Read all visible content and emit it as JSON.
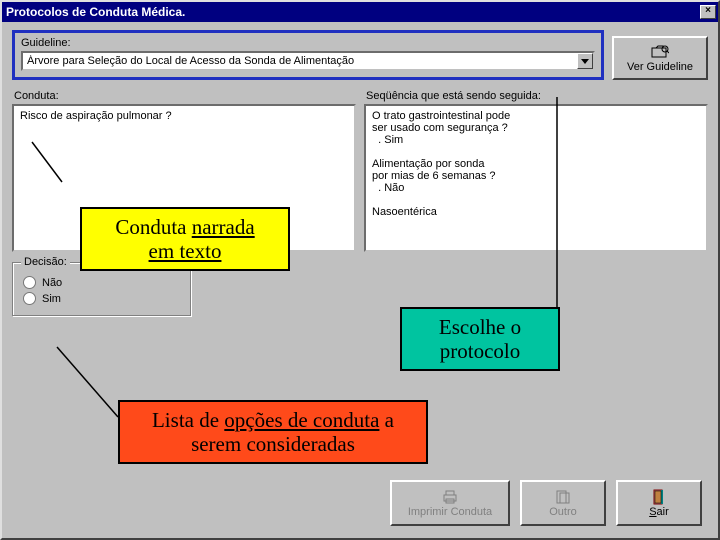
{
  "title": "Protocolos de Conduta Médica.",
  "guideline": {
    "label": "Guideline:",
    "value": "Árvore para Seleção do Local de Acesso da Sonda de Alimentação",
    "view_button": "Ver Guideline"
  },
  "conduta": {
    "label": "Conduta:",
    "text": "Risco de aspiração pulmonar ?"
  },
  "sequencia": {
    "label": "Seqüência que está sendo seguida:",
    "text": "O trato gastrointestinal pode\nser usado com segurança ?\n  . Sim\n\nAlimentação por sonda\npor mias de 6 semanas ?\n  . Não\n\nNasoentérica"
  },
  "decisao": {
    "legend": "Decisão:",
    "options": [
      "Não",
      "Sim"
    ]
  },
  "buttons": {
    "imprimir": "Imprimir Conduta",
    "outro": "Outro",
    "sair": "Sair"
  },
  "callouts": {
    "conduta_narrada_1": "Conduta ",
    "conduta_narrada_2": "narrada",
    "conduta_narrada_3": "em texto",
    "escolhe": "Escolhe o\nprotocolo",
    "lista_1": "Lista de ",
    "lista_2": "opções de conduta",
    "lista_3": " a\nserem consideradas"
  }
}
